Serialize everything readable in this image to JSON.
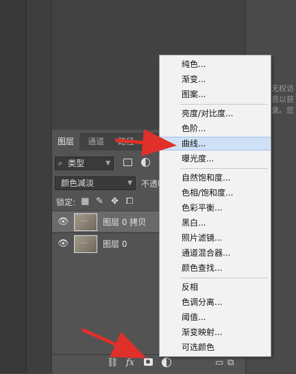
{
  "right_panel_text": "无权访\n员以获\n录。您",
  "layers_panel": {
    "tabs": [
      "图层",
      "通道",
      "路径"
    ],
    "filter": {
      "kind_label": "类型"
    },
    "blend_mode": "颜色减淡",
    "opacity_label": "不透明",
    "lock_label": "锁定:",
    "layers": [
      {
        "name": "图层 0 拷贝",
        "thumb_text": "..."
      },
      {
        "name": "图层 0",
        "thumb_text": "..."
      }
    ],
    "bottom_bar": {
      "fx_label": "fx"
    }
  },
  "adjustment_menu": {
    "groups": [
      [
        "纯色...",
        "渐变...",
        "图案..."
      ],
      [
        "亮度/对比度...",
        "色阶...",
        "曲线...",
        "曝光度..."
      ],
      [
        "自然饱和度...",
        "色相/饱和度...",
        "色彩平衡...",
        "黑白...",
        "照片滤镜...",
        "通道混合器...",
        "颜色查找..."
      ],
      [
        "反相",
        "色调分离...",
        "阈值...",
        "渐变映射...",
        "可选颜色"
      ]
    ],
    "highlighted_item": "曲线..."
  },
  "colors": {
    "arrow": "#e0302a",
    "menu_bg": "#f2f2f2",
    "menu_highlight": "#cfe1f6",
    "panel_bg": "#535353"
  },
  "icons": {
    "visibility": "eye-icon",
    "search": "search-icon",
    "link": "link-icon",
    "fx": "fx-icon",
    "mask": "mask-icon",
    "adjustment": "adjustment-layer-icon",
    "group": "folder-icon",
    "new_layer": "new-layer-icon"
  }
}
